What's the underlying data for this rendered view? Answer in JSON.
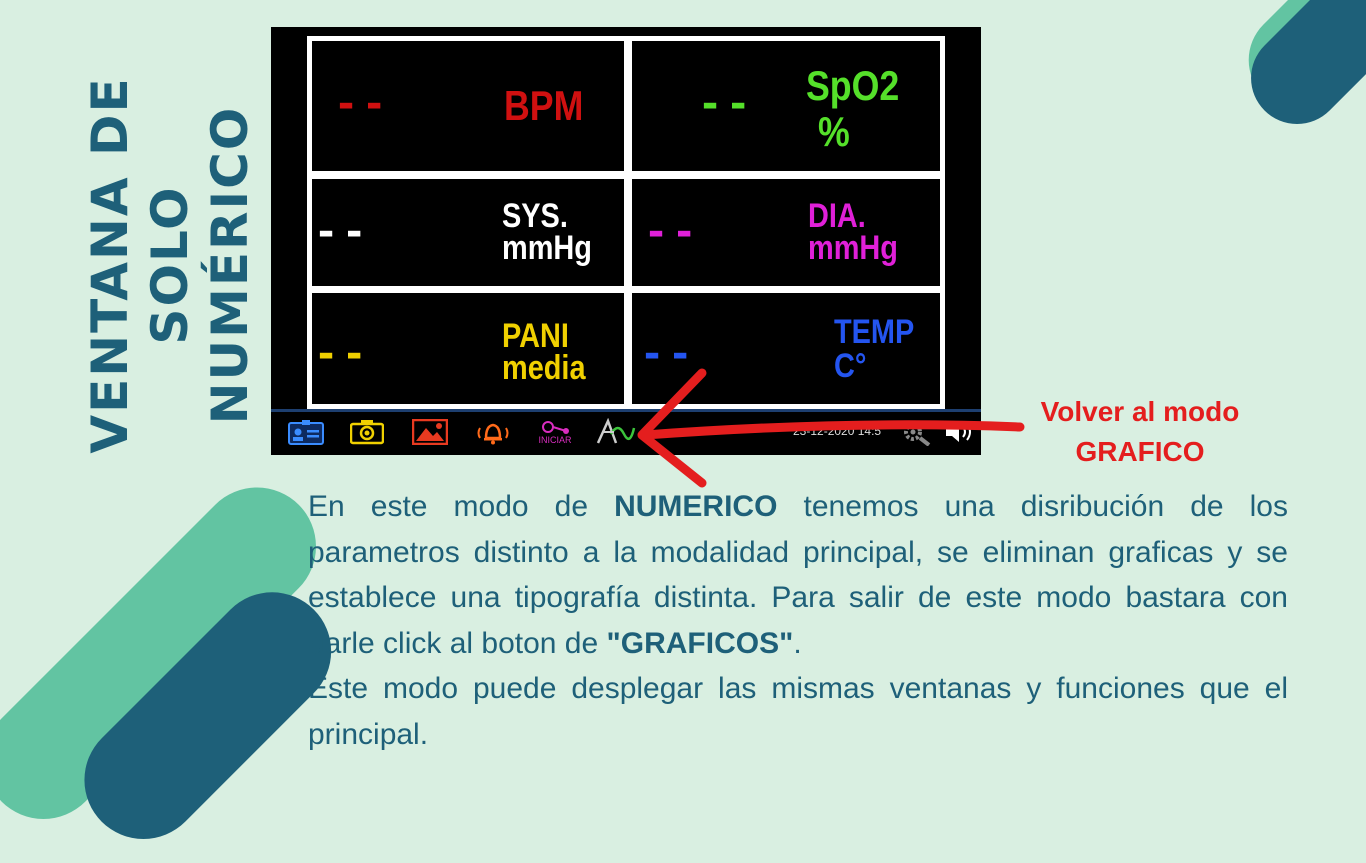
{
  "side_title": {
    "line1": "VENTANA DE",
    "line2": "SOLO NUMÉRICO"
  },
  "colors": {
    "accent_dark": "#1e6079",
    "accent_light": "#62c4a2",
    "callout": "#e41e1e"
  },
  "monitor": {
    "cells": [
      {
        "id": "bpm",
        "value": "--",
        "label1": "BPM",
        "label2": "",
        "color": "#d01010"
      },
      {
        "id": "spo2",
        "value": "--",
        "label1": "SpO2",
        "label2": "%",
        "color": "#55e02a"
      },
      {
        "id": "sys",
        "value": "--",
        "label1": "SYS.",
        "label2": "mmHg",
        "color": "#ffffff"
      },
      {
        "id": "dia",
        "value": "--",
        "label1": "DIA.",
        "label2": "mmHg",
        "color": "#e020d8"
      },
      {
        "id": "pani",
        "value": "--",
        "label1": "PANI",
        "label2": "media",
        "color": "#f0d000"
      },
      {
        "id": "temp",
        "value": "--",
        "label1": "TEMP",
        "label2": "C°",
        "color": "#2455f0"
      }
    ],
    "taskbar": {
      "icons": [
        "patient-info-icon",
        "camera-icon",
        "image-icon",
        "alarm-bell-icon",
        "start-nibp-icon",
        "graphics-mode-icon",
        "settings-icon",
        "sound-icon"
      ],
      "start_label": "INICIAR",
      "datetime": "23-12-2020 14:5"
    }
  },
  "callout": {
    "line1": "Volver al modo",
    "line2": "GRAFICO"
  },
  "description": {
    "p1_a": "En este modo de ",
    "p1_bold1": "NUMERICO",
    "p1_b": " tenemos una disribución de los parametros distinto a la modalidad principal, se eliminan graficas y se establece una tipografía distinta. Para salir de este modo bastara con darle click al boton de ",
    "p1_bold2": "\"GRAFICOS\"",
    "p1_c": ".",
    "p2": "Este modo puede desplegar las mismas ventanas y funciones que el principal."
  }
}
